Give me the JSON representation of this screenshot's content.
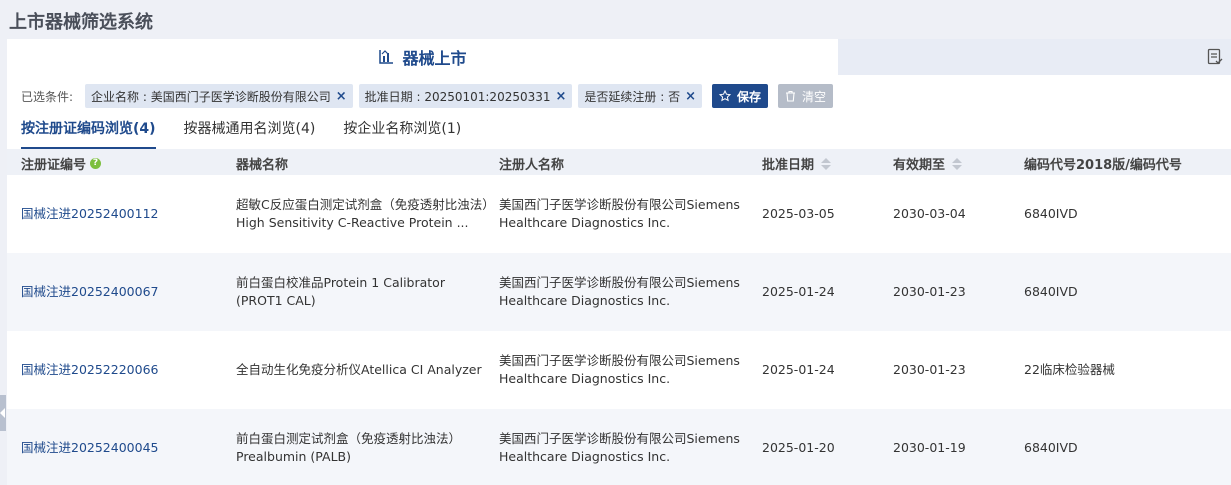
{
  "page": {
    "title": "上市器械筛选系统"
  },
  "main_tab": {
    "label": "器械上市"
  },
  "filters": {
    "label": "已选条件:",
    "chips": [
      {
        "text": "企业名称 : 美国西门子医学诊断股份有限公司"
      },
      {
        "text": "批准日期 : 20250101:20250331"
      },
      {
        "text": "是否延续注册 : 否"
      }
    ],
    "close_glyph": "×",
    "save_label": "保存",
    "clear_label": "清空"
  },
  "subtabs": [
    {
      "label": "按注册证编码浏览(4)",
      "active": true
    },
    {
      "label": "按器械通用名浏览(4)",
      "active": false
    },
    {
      "label": "按企业名称浏览(1)",
      "active": false
    }
  ],
  "table": {
    "headers": [
      "注册证编号",
      "器械名称",
      "注册人名称",
      "批准日期",
      "有效期至",
      "编码代号2018版/编码代号"
    ],
    "help_glyph": "?",
    "rows": [
      {
        "reg_no": "国械注进20252400112",
        "device": "超敏C反应蛋白测定试剂盒（免疫透射比浊法）High Sensitivity C-Reactive Protein ...",
        "registrant": "美国西门子医学诊断股份有限公司Siemens Healthcare Diagnostics Inc.",
        "approval_date": "2025-03-05",
        "valid_until": "2030-03-04",
        "code": "6840IVD"
      },
      {
        "reg_no": "国械注进20252400067",
        "device": "前白蛋白校准品Protein 1 Calibrator (PROT1 CAL)",
        "registrant": "美国西门子医学诊断股份有限公司Siemens Healthcare Diagnostics Inc.",
        "approval_date": "2025-01-24",
        "valid_until": "2030-01-23",
        "code": "6840IVD"
      },
      {
        "reg_no": "国械注进20252220066",
        "device": "全自动生化免疫分析仪Atellica CI Analyzer",
        "registrant": "美国西门子医学诊断股份有限公司Siemens Healthcare Diagnostics Inc.",
        "approval_date": "2025-01-24",
        "valid_until": "2030-01-23",
        "code": "22临床检验器械"
      },
      {
        "reg_no": "国械注进20252400045",
        "device": "前白蛋白测定试剂盒（免疫透射比浊法）Prealbumin (PALB)",
        "registrant": "美国西门子医学诊断股份有限公司Siemens Healthcare Diagnostics Inc.",
        "approval_date": "2025-01-20",
        "valid_until": "2030-01-19",
        "code": "6840IVD"
      }
    ]
  },
  "colors": {
    "accent": "#1f4a8c",
    "chip_bg": "#dfe6f2",
    "help": "#7cbf3f"
  }
}
